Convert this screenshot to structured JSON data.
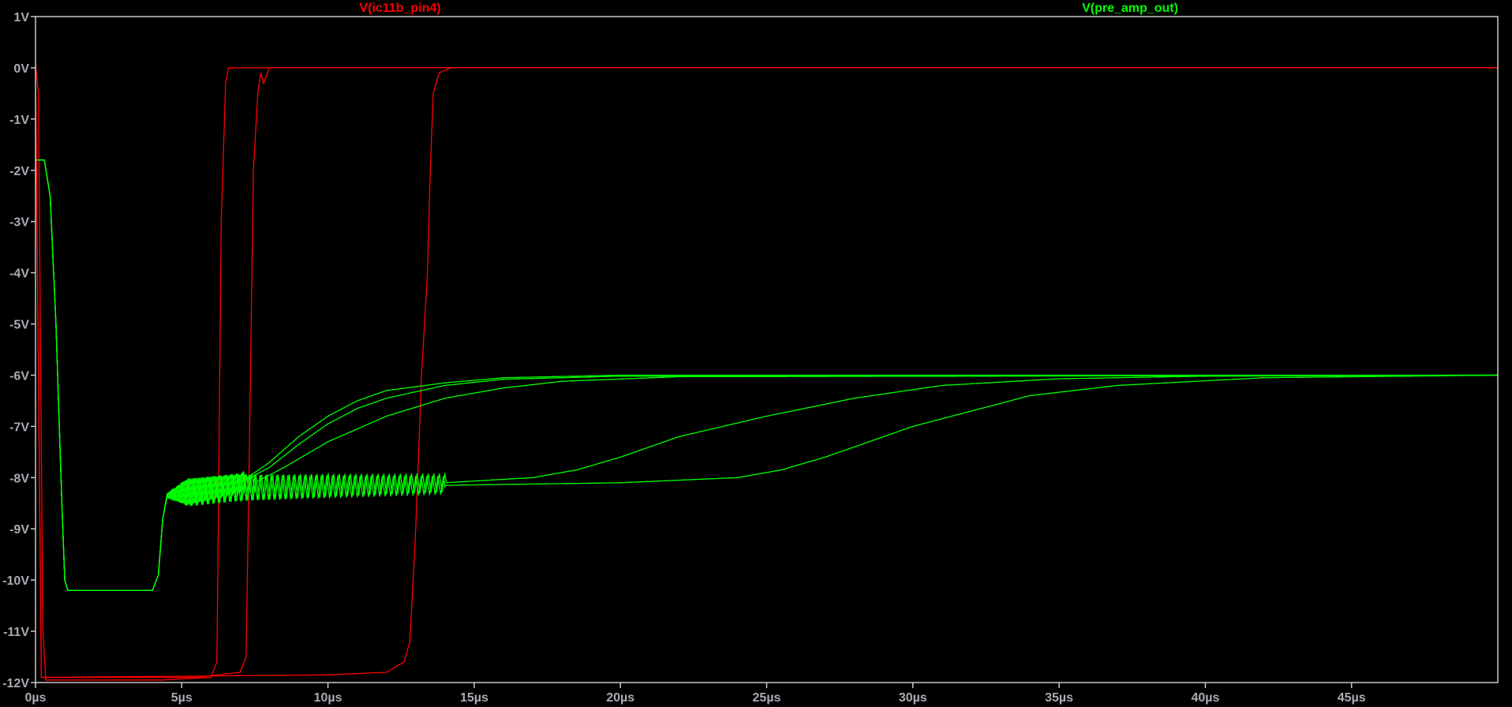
{
  "chart_data": {
    "type": "line",
    "title": "",
    "xlabel": "",
    "ylabel": "",
    "xlim": [
      0,
      50
    ],
    "ylim": [
      -12,
      1
    ],
    "grid": false,
    "x_unit": "µs",
    "y_unit": "V",
    "x_ticks": [
      0,
      5,
      10,
      15,
      20,
      25,
      30,
      35,
      40,
      45
    ],
    "x_tick_labels": [
      "0µs",
      "5µs",
      "10µs",
      "15µs",
      "20µs",
      "25µs",
      "30µs",
      "35µs",
      "40µs",
      "45µs"
    ],
    "y_ticks": [
      1,
      0,
      -1,
      -2,
      -3,
      -4,
      -5,
      -6,
      -7,
      -8,
      -9,
      -10,
      -11,
      -12
    ],
    "y_tick_labels": [
      "1V",
      "0V",
      "-1V",
      "-2V",
      "-3V",
      "-4V",
      "-5V",
      "-6V",
      "-7V",
      "-8V",
      "-9V",
      "-10V",
      "-11V",
      "-12V"
    ],
    "legend": [
      {
        "name": "V(ic11b_pin4)",
        "color": "#ff0000",
        "placement": "top-left"
      },
      {
        "name": "V(pre_amp_out)",
        "color": "#00ff00",
        "placement": "top-right"
      }
    ],
    "series": [
      {
        "name": "V(ic11b_pin4)",
        "color": "#ff0000",
        "step": 1,
        "points": [
          [
            0,
            0.1
          ],
          [
            0.1,
            -0.5
          ],
          [
            0.25,
            -11
          ],
          [
            0.35,
            -11.95
          ],
          [
            4.3,
            -11.95
          ],
          [
            6.0,
            -11.9
          ],
          [
            6.2,
            -11.6
          ],
          [
            6.25,
            -9
          ],
          [
            6.35,
            -3
          ],
          [
            6.5,
            -0.3
          ],
          [
            6.6,
            0
          ],
          [
            50,
            0
          ]
        ]
      },
      {
        "name": "V(ic11b_pin4)",
        "color": "#ff0000",
        "step": 2,
        "points": [
          [
            0,
            0
          ],
          [
            0.2,
            -11.9
          ],
          [
            5.5,
            -11.9
          ],
          [
            7.0,
            -11.8
          ],
          [
            7.2,
            -11.5
          ],
          [
            7.3,
            -8
          ],
          [
            7.45,
            -2
          ],
          [
            7.6,
            -0.5
          ],
          [
            7.7,
            -0.1
          ],
          [
            7.8,
            -0.3
          ],
          [
            8.0,
            0
          ],
          [
            50,
            0
          ]
        ]
      },
      {
        "name": "V(ic11b_pin4)",
        "color": "#ff0000",
        "step": 3,
        "points": [
          [
            0,
            0
          ],
          [
            0.2,
            -11.9
          ],
          [
            10,
            -11.85
          ],
          [
            12,
            -11.8
          ],
          [
            12.6,
            -11.6
          ],
          [
            12.8,
            -11.2
          ],
          [
            13.0,
            -9
          ],
          [
            13.2,
            -6
          ],
          [
            13.4,
            -4
          ],
          [
            13.5,
            -2
          ],
          [
            13.6,
            -0.5
          ],
          [
            13.8,
            -0.1
          ],
          [
            14.2,
            0
          ],
          [
            50,
            0
          ]
        ]
      },
      {
        "name": "V(pre_amp_out)",
        "color": "#00ff00",
        "step": 1,
        "ringing_until": 7.2,
        "points": [
          [
            0,
            -1.8
          ],
          [
            0.3,
            -1.8
          ],
          [
            0.5,
            -2.5
          ],
          [
            0.7,
            -5
          ],
          [
            0.9,
            -8.5
          ],
          [
            1.0,
            -10.0
          ],
          [
            1.1,
            -10.2
          ],
          [
            4.0,
            -10.2
          ],
          [
            4.2,
            -9.9
          ],
          [
            4.35,
            -8.8
          ],
          [
            4.5,
            -8.35
          ],
          [
            5,
            -8.3
          ],
          [
            6,
            -8.2
          ],
          [
            7,
            -8.1
          ],
          [
            8,
            -7.7
          ],
          [
            9,
            -7.2
          ],
          [
            10,
            -6.8
          ],
          [
            11,
            -6.5
          ],
          [
            12,
            -6.3
          ],
          [
            14,
            -6.15
          ],
          [
            16,
            -6.05
          ],
          [
            20,
            -6
          ],
          [
            50,
            -6
          ]
        ]
      },
      {
        "name": "V(pre_amp_out)",
        "color": "#00ff00",
        "step": 2,
        "ringing_until": 7.2,
        "points": [
          [
            0,
            -1.8
          ],
          [
            0.3,
            -1.8
          ],
          [
            0.5,
            -2.5
          ],
          [
            0.7,
            -5
          ],
          [
            0.9,
            -8.5
          ],
          [
            1.0,
            -10.0
          ],
          [
            1.1,
            -10.2
          ],
          [
            4.0,
            -10.2
          ],
          [
            4.2,
            -9.9
          ],
          [
            4.35,
            -8.8
          ],
          [
            4.5,
            -8.35
          ],
          [
            5,
            -8.3
          ],
          [
            6,
            -8.2
          ],
          [
            7,
            -8.1
          ],
          [
            8,
            -7.8
          ],
          [
            9,
            -7.35
          ],
          [
            10,
            -6.95
          ],
          [
            11,
            -6.65
          ],
          [
            12,
            -6.45
          ],
          [
            14,
            -6.2
          ],
          [
            16,
            -6.08
          ],
          [
            20,
            -6.02
          ],
          [
            50,
            -6
          ]
        ]
      },
      {
        "name": "V(pre_amp_out)",
        "color": "#00ff00",
        "step": 3,
        "ringing_until": 7.5,
        "points": [
          [
            0,
            -1.8
          ],
          [
            0.3,
            -1.8
          ],
          [
            0.5,
            -2.5
          ],
          [
            0.7,
            -5
          ],
          [
            0.9,
            -8.5
          ],
          [
            1.0,
            -10.0
          ],
          [
            1.1,
            -10.2
          ],
          [
            4.0,
            -10.2
          ],
          [
            4.2,
            -9.9
          ],
          [
            4.35,
            -8.8
          ],
          [
            4.5,
            -8.35
          ],
          [
            5,
            -8.3
          ],
          [
            6,
            -8.2
          ],
          [
            7.5,
            -8.1
          ],
          [
            8.5,
            -7.8
          ],
          [
            10,
            -7.3
          ],
          [
            12,
            -6.8
          ],
          [
            14,
            -6.45
          ],
          [
            16,
            -6.25
          ],
          [
            18,
            -6.12
          ],
          [
            22,
            -6.03
          ],
          [
            50,
            -6
          ]
        ]
      },
      {
        "name": "V(pre_amp_out)",
        "color": "#00ff00",
        "step": 4,
        "ringing_until": 14,
        "points": [
          [
            0,
            -1.8
          ],
          [
            0.3,
            -1.8
          ],
          [
            0.5,
            -2.5
          ],
          [
            0.7,
            -5
          ],
          [
            0.9,
            -8.5
          ],
          [
            1.0,
            -10.0
          ],
          [
            1.1,
            -10.2
          ],
          [
            4.0,
            -10.2
          ],
          [
            4.2,
            -9.9
          ],
          [
            4.35,
            -8.8
          ],
          [
            4.5,
            -8.35
          ],
          [
            5,
            -8.3
          ],
          [
            7,
            -8.2
          ],
          [
            10,
            -8.15
          ],
          [
            14,
            -8.1
          ],
          [
            17,
            -8.0
          ],
          [
            18.5,
            -7.85
          ],
          [
            20,
            -7.6
          ],
          [
            22,
            -7.2
          ],
          [
            25,
            -6.8
          ],
          [
            28,
            -6.45
          ],
          [
            31,
            -6.2
          ],
          [
            35,
            -6.07
          ],
          [
            40,
            -6.02
          ],
          [
            50,
            -6
          ]
        ]
      },
      {
        "name": "V(pre_amp_out)",
        "color": "#00ff00",
        "step": 5,
        "ringing_until": 14,
        "points": [
          [
            0,
            -1.8
          ],
          [
            0.3,
            -1.8
          ],
          [
            0.5,
            -2.5
          ],
          [
            0.7,
            -5
          ],
          [
            0.9,
            -8.5
          ],
          [
            1.0,
            -10.0
          ],
          [
            1.1,
            -10.2
          ],
          [
            4.0,
            -10.2
          ],
          [
            4.2,
            -9.9
          ],
          [
            4.35,
            -8.8
          ],
          [
            4.5,
            -8.35
          ],
          [
            5,
            -8.3
          ],
          [
            7,
            -8.2
          ],
          [
            10,
            -8.18
          ],
          [
            14,
            -8.15
          ],
          [
            20,
            -8.1
          ],
          [
            24,
            -8.0
          ],
          [
            25.5,
            -7.85
          ],
          [
            27,
            -7.6
          ],
          [
            28.5,
            -7.3
          ],
          [
            30,
            -7.0
          ],
          [
            32,
            -6.7
          ],
          [
            34,
            -6.4
          ],
          [
            37,
            -6.2
          ],
          [
            42,
            -6.05
          ],
          [
            50,
            -6
          ]
        ]
      }
    ],
    "ringing": {
      "start_us": 4.4,
      "amplitude_v": 0.28,
      "period_us": 0.19
    }
  }
}
